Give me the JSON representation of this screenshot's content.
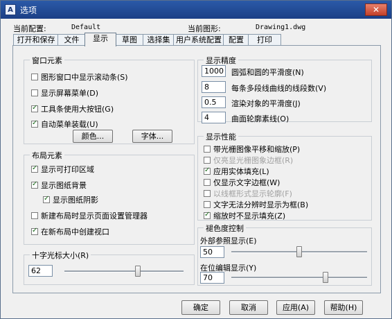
{
  "window": {
    "title": "选项",
    "close_glyph": "✕",
    "app_icon": "A"
  },
  "config": {
    "current_profile_label": "当前配置:",
    "current_profile_value": "Default",
    "current_drawing_label": "当前图形:",
    "current_drawing_value": "Drawing1.dwg"
  },
  "tabs": [
    "打开和保存",
    "文件",
    "显示",
    "草图",
    "选择集",
    "用户系统配置",
    "配置",
    "打印"
  ],
  "window_elements": {
    "title": "窗口元素",
    "items": [
      {
        "label": "图形窗口中显示滚动条(S)",
        "checked": false
      },
      {
        "label": "显示屏幕菜单(D)",
        "checked": false
      },
      {
        "label": "工具条使用大按钮(G)",
        "checked": true
      },
      {
        "label": "自动菜单装载(U)",
        "checked": true
      }
    ],
    "color_button": "颜色...",
    "font_button": "字体..."
  },
  "layout_elements": {
    "title": "布局元素",
    "items": [
      {
        "label": "显示可打印区域",
        "checked": true
      },
      {
        "label": "显示图纸背景",
        "checked": true
      },
      {
        "label": "显示图纸阴影",
        "checked": true
      },
      {
        "label": "新建布局时显示页面设置管理器",
        "checked": false
      },
      {
        "label": "在新布局中创建视口",
        "checked": true
      }
    ]
  },
  "crosshair": {
    "title": "十字光标大小(R)",
    "value": "62",
    "slider_fraction": 0.62
  },
  "display_precision": {
    "title": "显示精度",
    "rows": [
      {
        "value": "1000",
        "label": "圆弧和圆的平滑度(N)"
      },
      {
        "value": "8",
        "label": "每条多段线曲线的线段数(V)"
      },
      {
        "value": "0.5",
        "label": "渲染对象的平滑度(J)"
      },
      {
        "value": "4",
        "label": "曲面轮廓素线(O)"
      }
    ]
  },
  "display_performance": {
    "title": "显示性能",
    "items": [
      {
        "label": "带光栅图像平移和缩放(P)",
        "checked": false,
        "disabled": false
      },
      {
        "label": "仅亮显光栅图象边框(R)",
        "checked": false,
        "disabled": true
      },
      {
        "label": "应用实体填充(L)",
        "checked": true,
        "disabled": false
      },
      {
        "label": "仅显示文字边框(W)",
        "checked": false,
        "disabled": false
      },
      {
        "label": "以线框形式显示轮廓(F)",
        "checked": false,
        "disabled": true
      },
      {
        "label": "文字无法分辨时显示为框(B)",
        "checked": false,
        "disabled": false
      },
      {
        "label": "缩放时不显示填充(Z)",
        "checked": true,
        "disabled": false
      }
    ]
  },
  "fade": {
    "title": "褪色度控制",
    "xref_label": "外部参照显示(E)",
    "xref_value": "50",
    "xref_fraction": 0.5,
    "inplace_label": "在位编辑显示(Y)",
    "inplace_value": "70",
    "inplace_fraction": 0.7
  },
  "buttons": {
    "ok": "确定",
    "cancel": "取消",
    "apply": "应用(A)",
    "help": "帮助(H)"
  }
}
